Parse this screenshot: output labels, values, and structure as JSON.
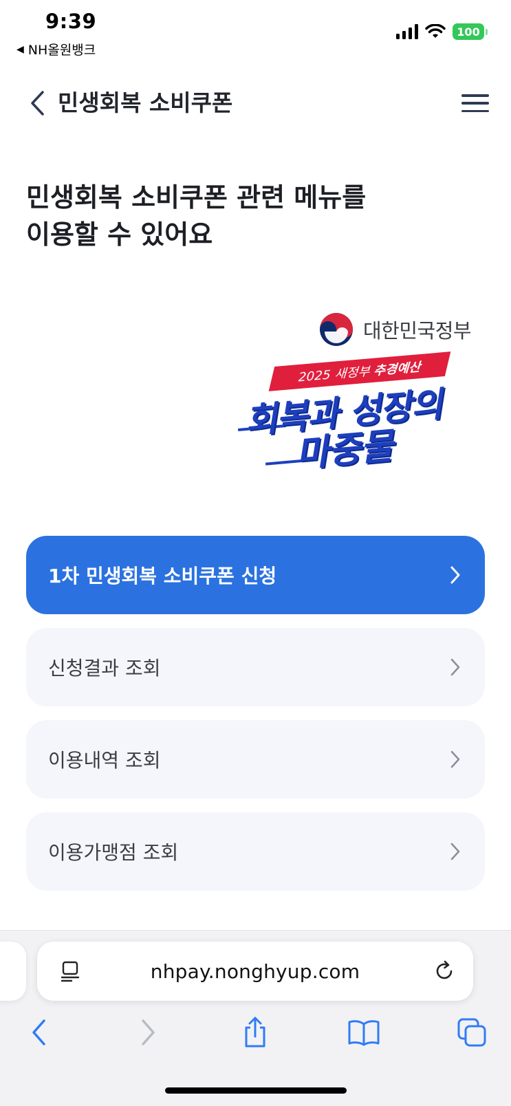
{
  "status_bar": {
    "time": "9:39",
    "back_app": "NH올원뱅크",
    "battery": "100"
  },
  "header": {
    "title": "민생회복 소비쿠폰"
  },
  "intro": {
    "line1": "민생회복 소비쿠폰 관련 메뉴를",
    "line2": "이용할 수 있어요"
  },
  "banner": {
    "government": "대한민국정부",
    "ribbon_prefix": "2025 새정부",
    "ribbon_emphasis": "추경예산",
    "slogan_line1": "회복과 성장의",
    "slogan_line2": "마중물"
  },
  "menu": {
    "items": [
      {
        "label": "1차 민생회복 소비쿠폰 신청",
        "primary": true
      },
      {
        "label": "신청결과 조회",
        "primary": false
      },
      {
        "label": "이용내역 조회",
        "primary": false
      },
      {
        "label": "이용가맹점 조회",
        "primary": false
      }
    ]
  },
  "browser": {
    "url": "nhpay.nonghyup.com"
  },
  "colors": {
    "primary": "#2b72e0",
    "item_bg": "#f4f6fb",
    "safari_blue": "#2f7cf6",
    "ribbon_red": "#e01f3d",
    "slogan_blue": "#1d3fbf"
  }
}
